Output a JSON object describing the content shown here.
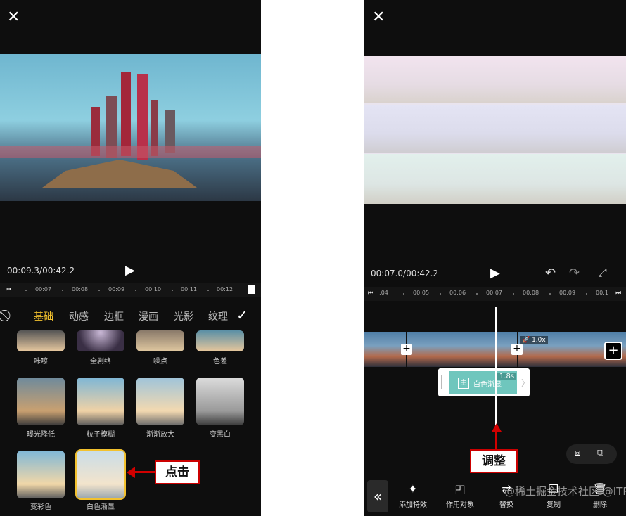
{
  "left": {
    "time_display": "00:09.3/00:42.2",
    "ruler_ticks": [
      "00:07",
      "00:08",
      "00:09",
      "00:10",
      "00:11",
      "00:12"
    ],
    "category_tabs": [
      {
        "label": "基础",
        "active": true
      },
      {
        "label": "动感",
        "active": false
      },
      {
        "label": "边框",
        "active": false
      },
      {
        "label": "漫画",
        "active": false
      },
      {
        "label": "光影",
        "active": false
      },
      {
        "label": "纹理",
        "active": false
      }
    ],
    "effects_row1": [
      "咔嚓",
      "全剧终",
      "噪点",
      "色差"
    ],
    "effects_row2": [
      "曝光降低",
      "粒子模糊",
      "渐渐放大",
      "变黑白"
    ],
    "effects_row3": [
      "变彩色",
      "白色渐显"
    ],
    "selected_effect": "白色渐显",
    "callout": "点击"
  },
  "right": {
    "time_display": "00:07.0/00:42.2",
    "ruler_ticks": [
      ":04",
      "00:05",
      "00:06",
      "00:07",
      "00:08",
      "00:09",
      "00:1"
    ],
    "speed_badge": "1.0x",
    "effect_clip": {
      "duration": "1.8s",
      "label": "白色渐显"
    },
    "callout": "调整",
    "toolbar": [
      "添加特效",
      "作用对象",
      "替换",
      "复制",
      "删除"
    ]
  },
  "watermark": "@稀土掘金技术社区 @ITPUB博客",
  "colors": {
    "accent": "#f2c12e",
    "annotation": "#d10000",
    "effect_clip": "#6fc6bd"
  }
}
